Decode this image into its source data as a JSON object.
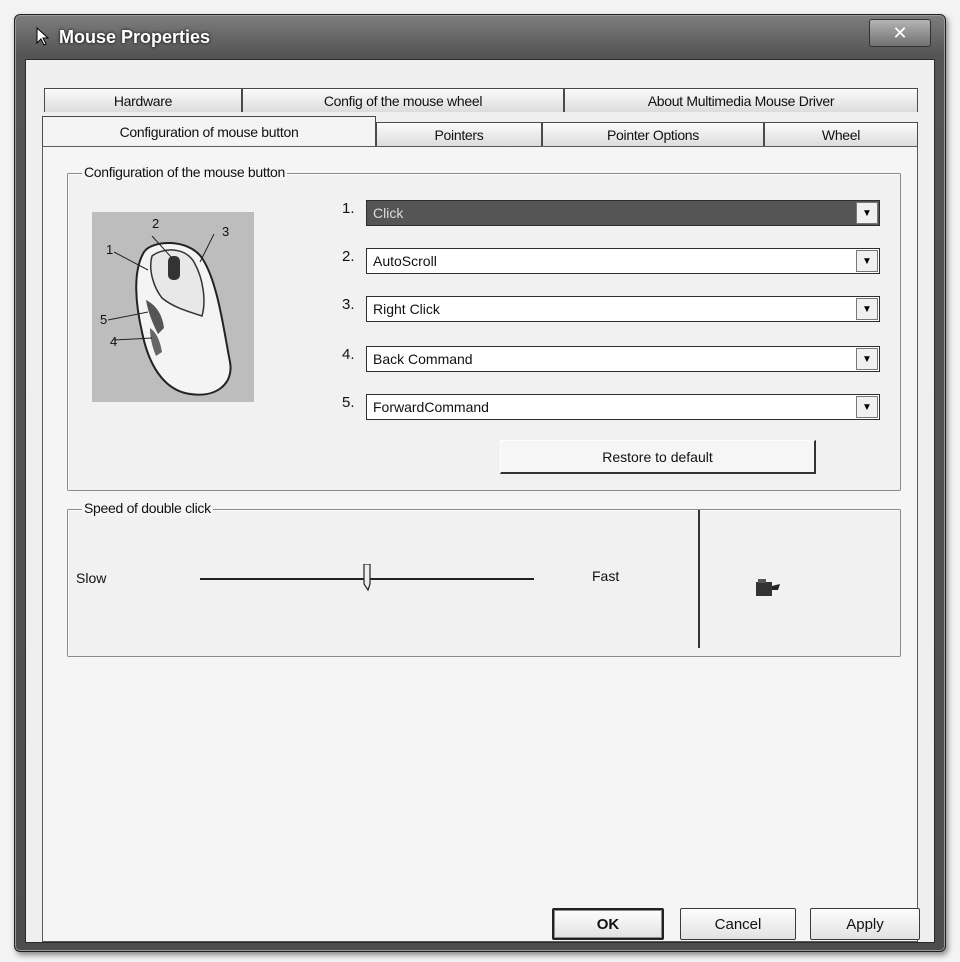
{
  "window": {
    "title": "Mouse Properties",
    "close_glyph": "✕",
    "accent_color": "#4d4d4d"
  },
  "tabs_back": [
    {
      "label": "Hardware"
    },
    {
      "label": "Config of the mouse wheel"
    },
    {
      "label": "About Multimedia Mouse Driver"
    }
  ],
  "tabs_front": [
    {
      "label": "Configuration of mouse button",
      "active": true
    },
    {
      "label": "Pointers"
    },
    {
      "label": "Pointer Options"
    },
    {
      "label": "Wheel"
    }
  ],
  "button_config": {
    "legend": "Configuration of the mouse button",
    "image_labels": [
      "1",
      "2",
      "3",
      "4",
      "5"
    ],
    "buttons": [
      {
        "number": "1.",
        "value": "Click"
      },
      {
        "number": "2.",
        "value": "AutoScroll"
      },
      {
        "number": "3.",
        "value": "Right Click"
      },
      {
        "number": "4.",
        "value": "Back Command"
      },
      {
        "number": "5.",
        "value": "ForwardCommand"
      }
    ],
    "restore_label": "Restore to default"
  },
  "double_click": {
    "legend": "Speed of double click",
    "slow_label": "Slow",
    "fast_label": "Fast",
    "speed_fraction": 0.5,
    "test_icon": "folder-icon"
  },
  "footer": {
    "ok_label": "OK",
    "cancel_label": "Cancel",
    "apply_label": "Apply"
  }
}
